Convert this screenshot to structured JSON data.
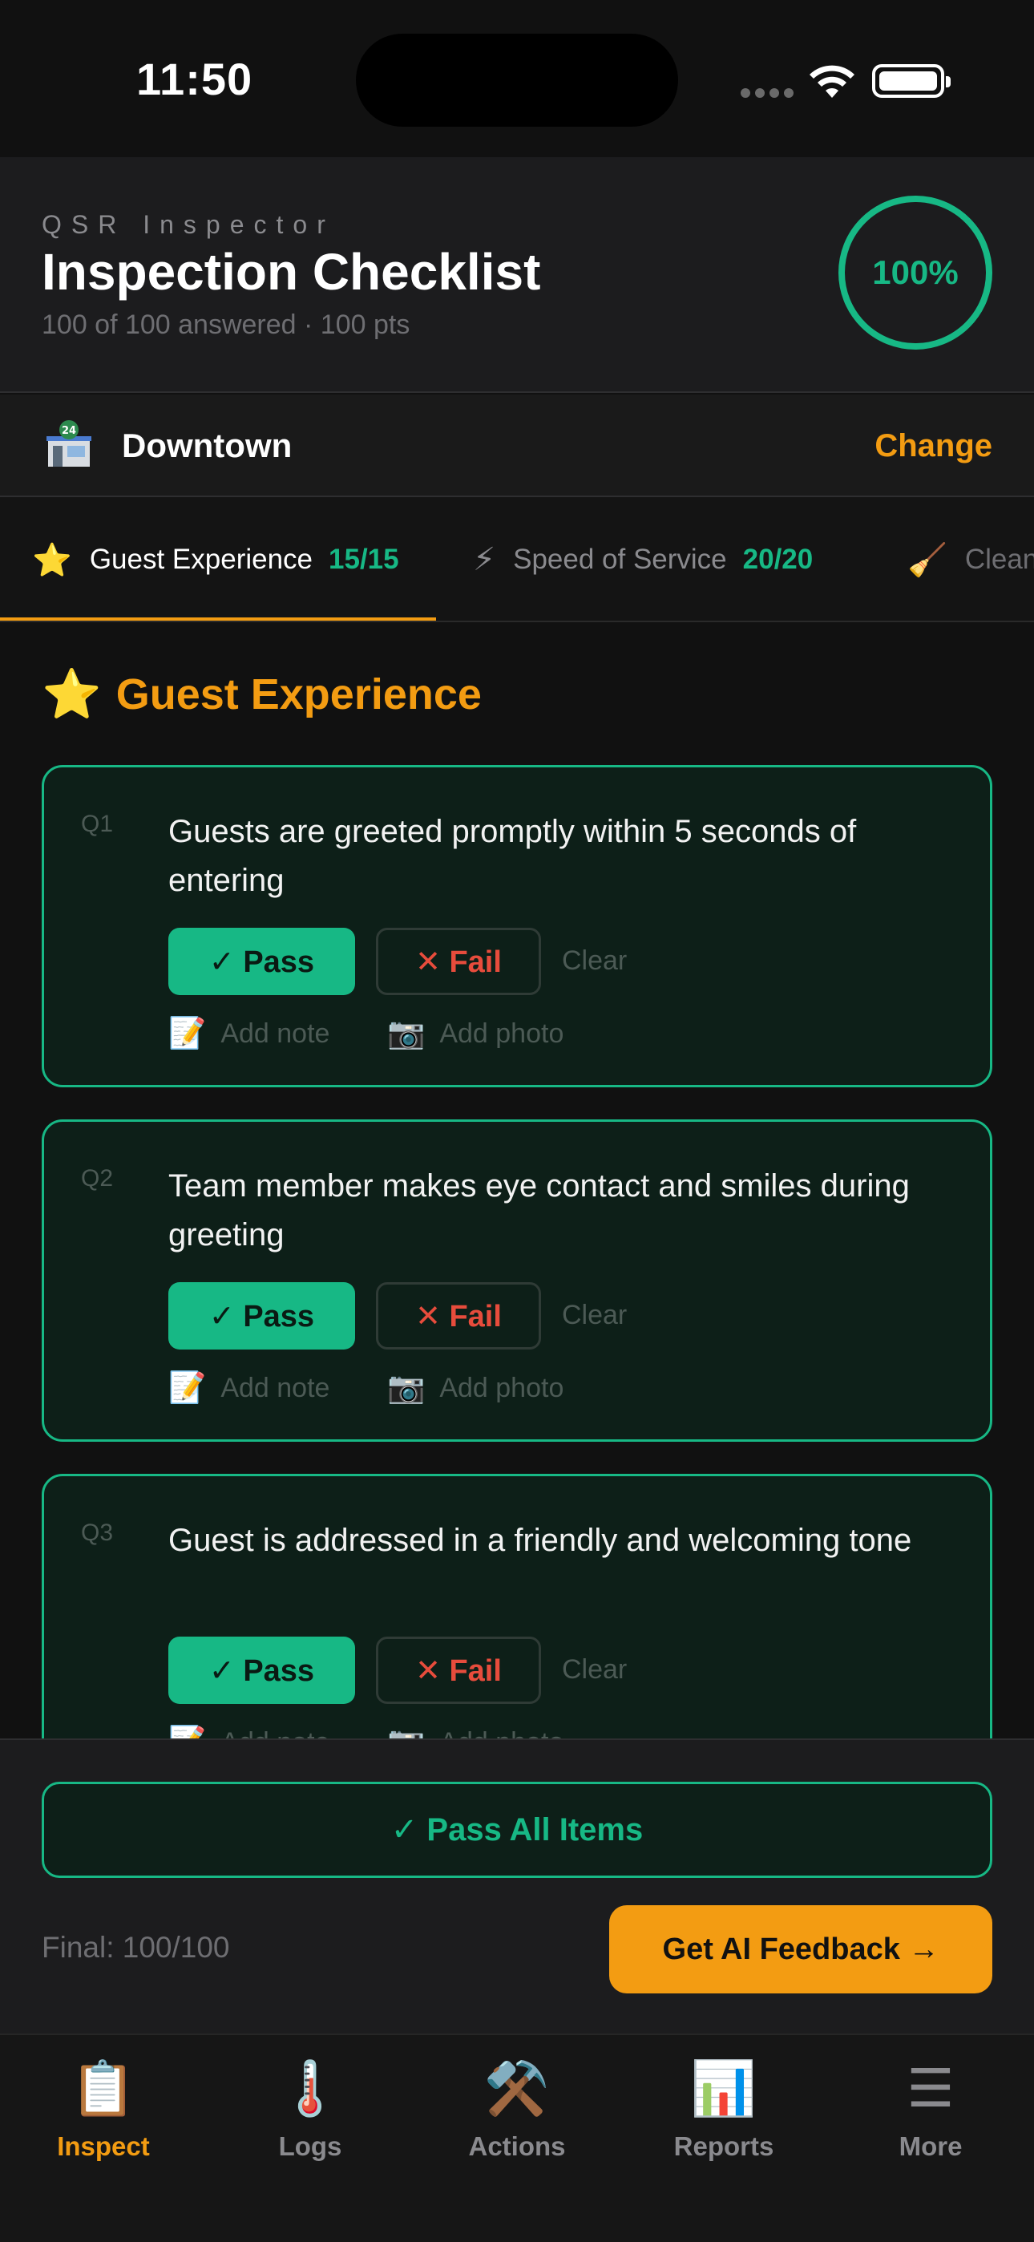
{
  "status_bar": {
    "time": "11:50"
  },
  "header": {
    "app_label": "QSR Inspector",
    "title": "Inspection Checklist",
    "subtitle": "100 of 100 answered · 100 pts",
    "progress": "100%"
  },
  "location": {
    "name": "Downtown",
    "change_label": "Change"
  },
  "tabs": [
    {
      "icon": "⭐",
      "label": "Guest Experience",
      "count": "15/15"
    },
    {
      "icon": "⚡",
      "label": "Speed of Service",
      "count": "20/20"
    },
    {
      "icon": "🧹",
      "label": "Clean"
    }
  ],
  "section": {
    "icon": "⭐",
    "title": "Guest Experience"
  },
  "questions": [
    {
      "num": "Q1",
      "text": "Guests are greeted promptly within 5 seconds of entering",
      "pass": "✓ Pass",
      "fail": "✕ Fail",
      "clear": "Clear",
      "note": "Add note",
      "photo": "Add photo"
    },
    {
      "num": "Q2",
      "text": "Team member makes eye contact and smiles during greeting",
      "pass": "✓ Pass",
      "fail": "✕ Fail",
      "clear": "Clear",
      "note": "Add note",
      "photo": "Add photo"
    },
    {
      "num": "Q3",
      "text": "Guest is addressed in a friendly and welcoming tone",
      "pass": "✓ Pass",
      "fail": "✕ Fail",
      "clear": "Clear",
      "note": "Add note",
      "photo": "Add photo"
    }
  ],
  "actions": {
    "pass_all": "✓ Pass All Items",
    "final": "Final: 100/100",
    "ai_feedback": "Get AI Feedback →"
  },
  "nav": [
    {
      "icon": "📋",
      "label": "Inspect"
    },
    {
      "icon": "🌡️",
      "label": "Logs"
    },
    {
      "icon": "⚒️",
      "label": "Actions"
    },
    {
      "icon": "📊",
      "label": "Reports"
    },
    {
      "icon": "☰",
      "label": "More"
    }
  ],
  "colors": {
    "accent": "#f39c12",
    "success": "#17b885",
    "danger": "#e74c3c",
    "background": "#111111"
  }
}
